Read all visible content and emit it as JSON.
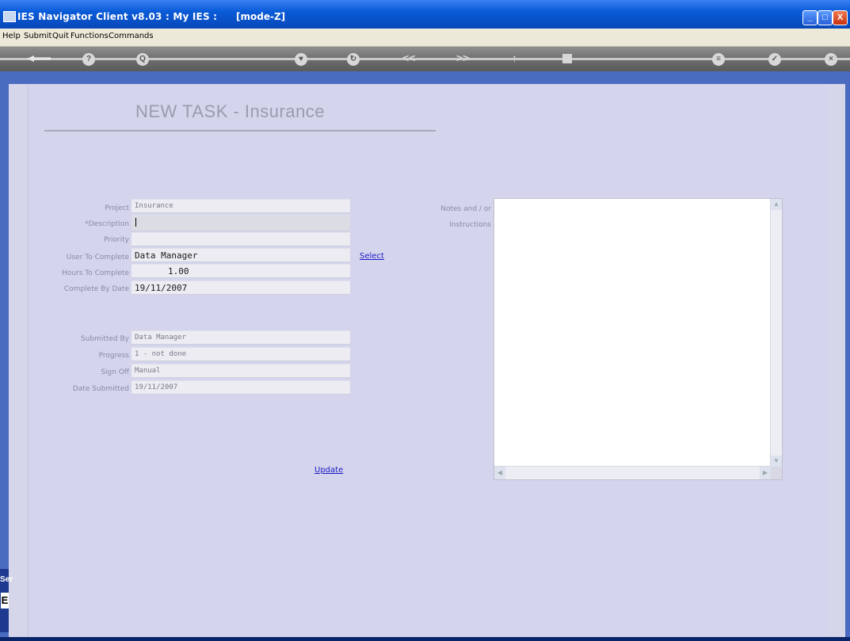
{
  "window": {
    "title": "IES Navigator Client v8.03 : My IES :",
    "mode": "[mode-Z]",
    "minimize_glyph": "_",
    "maximize_glyph": "□",
    "close_glyph": "X"
  },
  "menu": {
    "items": [
      "Help",
      "Submit",
      "Quit",
      "Functions",
      "Commands"
    ]
  },
  "toolbar": {
    "buttons": [
      {
        "name": "back-arrow-icon"
      },
      {
        "name": "help-icon",
        "glyph": "?"
      },
      {
        "name": "search-icon",
        "glyph": "Q"
      },
      {
        "name": "heart-icon"
      },
      {
        "name": "refresh-icon"
      },
      {
        "name": "prev-icon",
        "glyph": "<<"
      },
      {
        "name": "next-icon",
        "glyph": ">>"
      },
      {
        "name": "up-icon",
        "glyph": "↑"
      },
      {
        "name": "stop-icon"
      },
      {
        "name": "menu-icon"
      },
      {
        "name": "ok-icon"
      },
      {
        "name": "close-icon"
      }
    ]
  },
  "page": {
    "title": "NEW TASK - Insurance"
  },
  "form": {
    "project_label": "Project",
    "project_value": "Insurance",
    "description_label": "*Description",
    "description_value": "",
    "priority_label": "Priority",
    "priority_value": "",
    "user_label": "User To Complete",
    "user_value": "Data Manager",
    "hours_label": "Hours To Complete",
    "hours_value": "1.00",
    "complete_by_label": "Complete By Date",
    "complete_by_value": "19/11/2007",
    "select_link": "Select",
    "submitted_by_label": "Submitted By",
    "submitted_by_value": "Data Manager",
    "progress_label": "Progress",
    "progress_value": "1 - not done",
    "signoff_label": "Sign Off",
    "signoff_value": "Manual",
    "date_submitted_label": "Date Submitted",
    "date_submitted_value": "19/11/2007",
    "update_link": "Update",
    "notes_label_line1": "Notes and / or",
    "notes_label_line2": "Instructions",
    "notes_value": ""
  },
  "taskbar": {
    "tab_text": "Ser",
    "square_char": "E"
  }
}
